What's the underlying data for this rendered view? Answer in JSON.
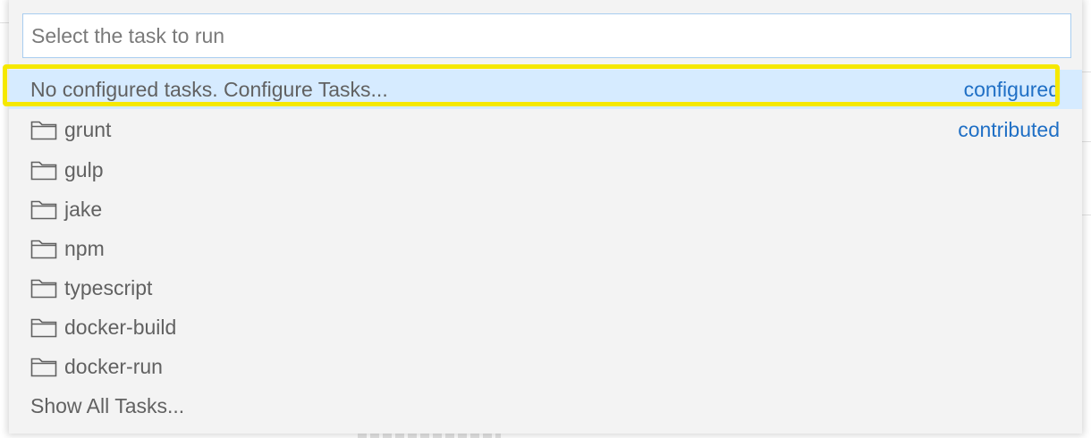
{
  "quick_pick": {
    "placeholder": "Select the task to run",
    "items": [
      {
        "label": "No configured tasks. Configure Tasks...",
        "badge": "configured",
        "icon": "",
        "selected": true
      },
      {
        "label": "grunt",
        "badge": "contributed",
        "icon": "folder-icon"
      },
      {
        "label": "gulp",
        "badge": "",
        "icon": "folder-icon"
      },
      {
        "label": "jake",
        "badge": "",
        "icon": "folder-icon"
      },
      {
        "label": "npm",
        "badge": "",
        "icon": "folder-icon"
      },
      {
        "label": "typescript",
        "badge": "",
        "icon": "folder-icon"
      },
      {
        "label": "docker-build",
        "badge": "",
        "icon": "folder-icon"
      },
      {
        "label": "docker-run",
        "badge": "",
        "icon": "folder-icon"
      },
      {
        "label": "Show All Tasks...",
        "badge": "",
        "icon": ""
      }
    ]
  },
  "colors": {
    "badge": "#1f6fc5",
    "selection": "#d6ebff",
    "highlight_border": "#f5e800",
    "input_border": "#a8cdf0"
  }
}
